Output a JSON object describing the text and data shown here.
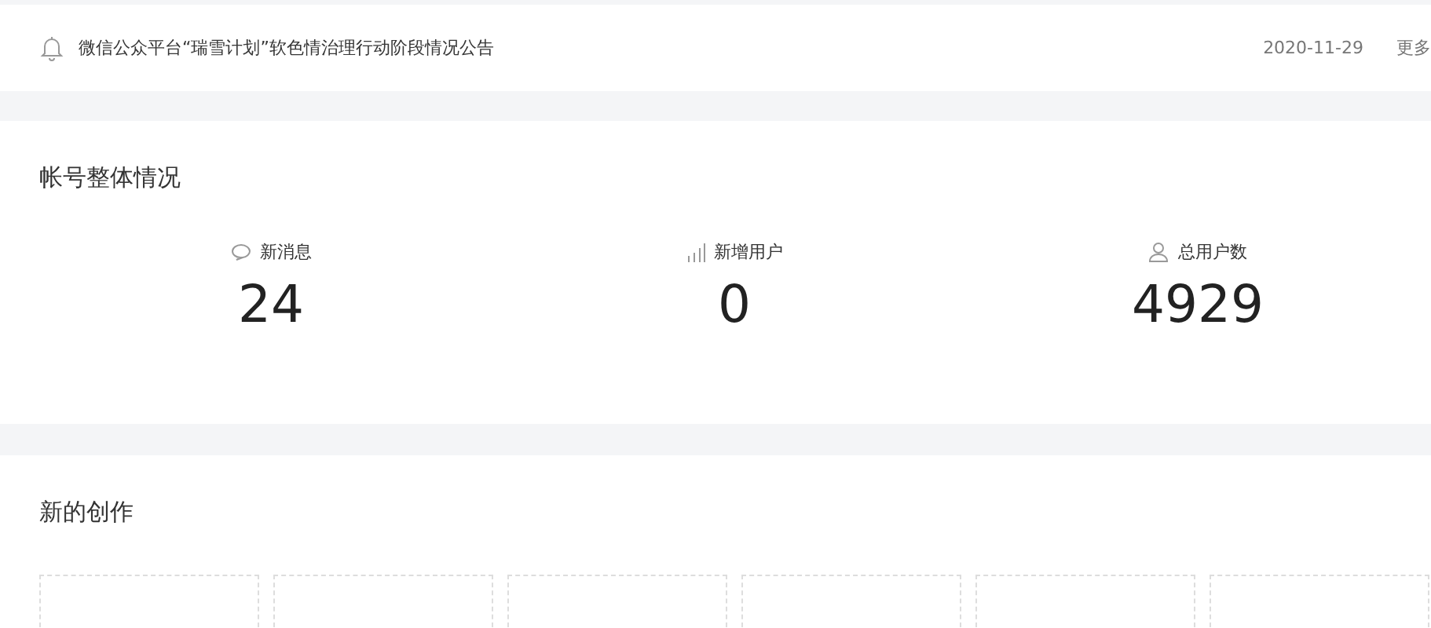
{
  "notice": {
    "title": "微信公众平台“瑞雪计划”软色情治理行动阶段情况公告",
    "date": "2020-11-29",
    "more": "更多"
  },
  "overview": {
    "title": "帐号整体情况",
    "stats": [
      {
        "kind": "messages",
        "label": "新消息",
        "value": "24"
      },
      {
        "kind": "new_users",
        "label": "新增用户",
        "value": "0"
      },
      {
        "kind": "total_users",
        "label": "总用户数",
        "value": "4929"
      }
    ]
  },
  "creations": {
    "title": "新的创作",
    "items": [
      {
        "kind": "empty"
      },
      {
        "kind": "empty"
      },
      {
        "kind": "empty"
      },
      {
        "kind": "empty"
      },
      {
        "kind": "empty"
      },
      {
        "kind": "empty"
      }
    ]
  }
}
